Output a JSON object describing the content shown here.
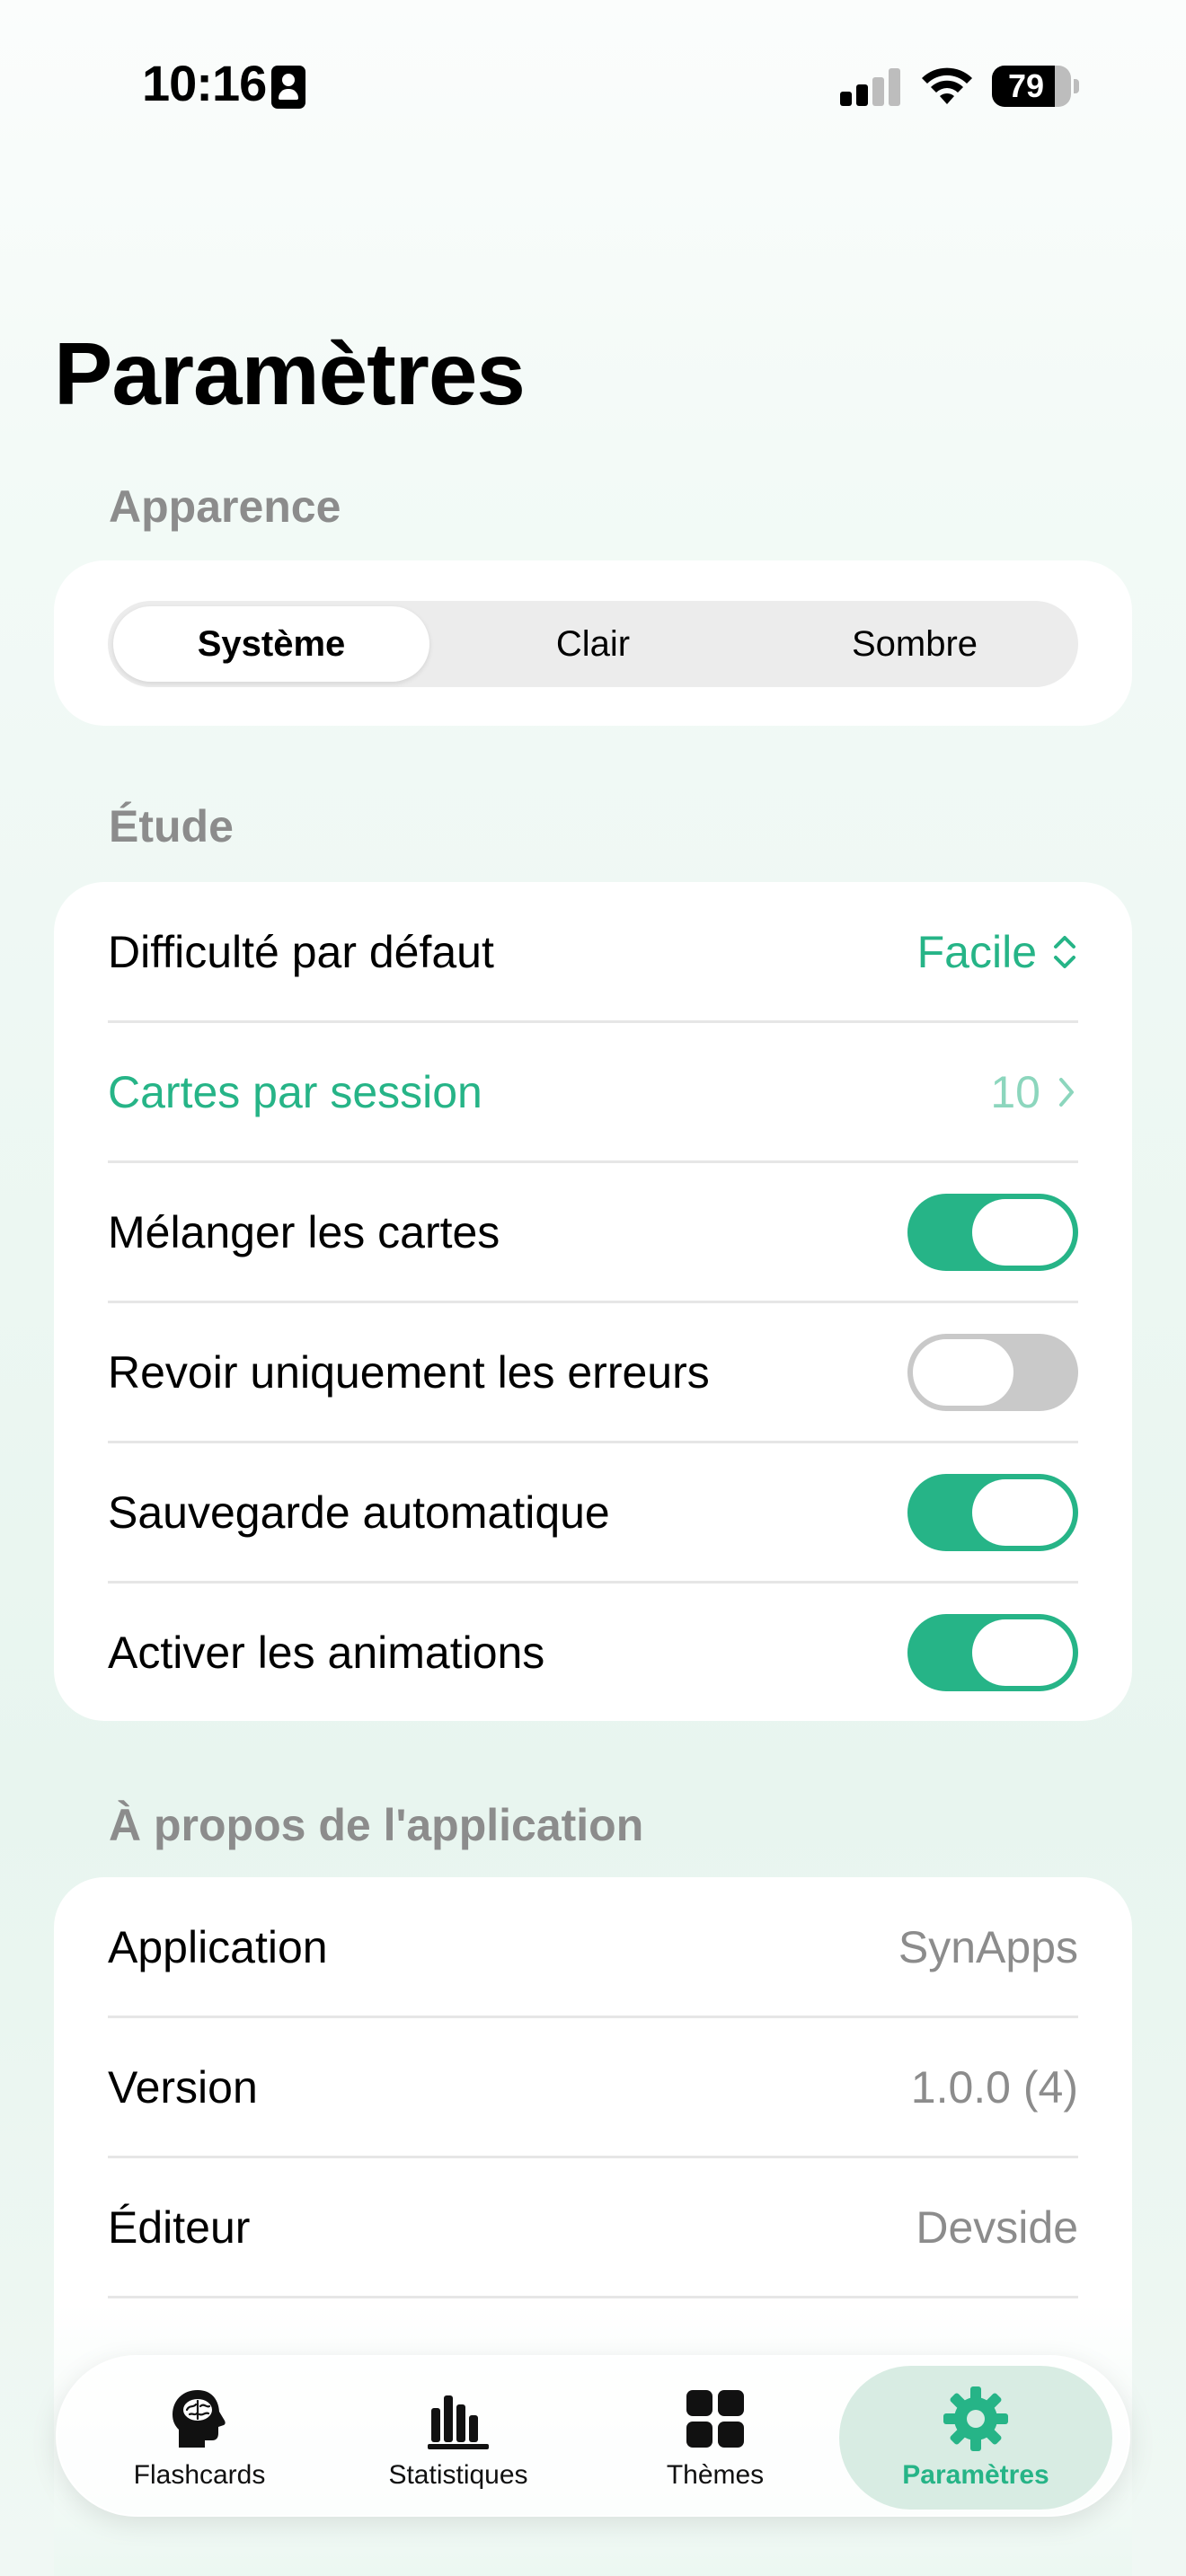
{
  "status_bar": {
    "time": "10:16",
    "battery": "79",
    "battery_level": 0.79
  },
  "page": {
    "title": "Paramètres"
  },
  "appearance": {
    "header": "Apparence",
    "options": [
      "Système",
      "Clair",
      "Sombre"
    ],
    "selected": "Système"
  },
  "study": {
    "header": "Étude",
    "difficulty": {
      "label": "Difficulté par défaut",
      "value": "Facile"
    },
    "cards_per_session": {
      "label": "Cartes par session",
      "value": "10"
    },
    "shuffle": {
      "label": "Mélanger les cartes",
      "on": true
    },
    "errors_only": {
      "label": "Revoir uniquement les erreurs",
      "on": false
    },
    "autosave": {
      "label": "Sauvegarde automatique",
      "on": true
    },
    "animations": {
      "label": "Activer les animations",
      "on": true
    }
  },
  "about": {
    "header": "À propos de l'application",
    "app": {
      "label": "Application",
      "value": "SynApps"
    },
    "version": {
      "label": "Version",
      "value": "1.0.0 (4)"
    },
    "publisher": {
      "label": "Éditeur",
      "value": "Devside"
    }
  },
  "tabs": [
    {
      "label": "Flashcards",
      "icon": "brain-head-icon"
    },
    {
      "label": "Statistiques",
      "icon": "bar-chart-icon"
    },
    {
      "label": "Thèmes",
      "icon": "grid-icon"
    },
    {
      "label": "Paramètres",
      "icon": "gear-icon",
      "active": true
    }
  ],
  "colors": {
    "accent": "#26b487",
    "accent_light": "#8cd6bd",
    "secondary_text": "#8c8c8c"
  }
}
